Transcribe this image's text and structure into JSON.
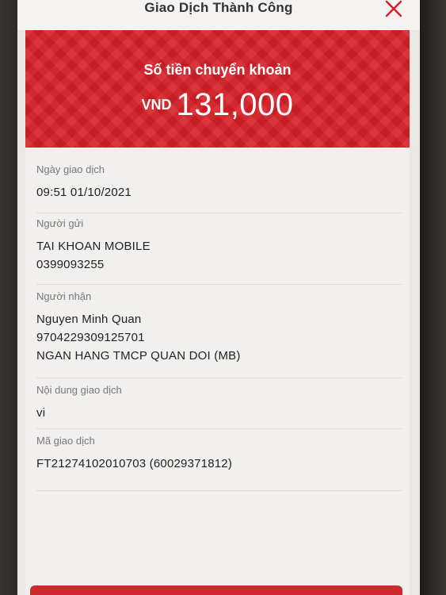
{
  "header": {
    "title": "Giao Dịch Thành Công"
  },
  "summary": {
    "label": "Số tiền chuyển khoản",
    "currency": "VND",
    "amount": "131,000"
  },
  "details": {
    "date": {
      "label": "Ngày giao dịch",
      "value": "09:51 01/10/2021"
    },
    "sender": {
      "label": "Người gửi",
      "name": "TAI KHOAN MOBILE",
      "account": "0399093255"
    },
    "recipient": {
      "label": "Người nhận",
      "name": "Nguyen Minh Quan",
      "account": "9704229309125701",
      "bank": "NGAN HANG TMCP QUAN DOI (MB)"
    },
    "content": {
      "label": "Nội dung giao dịch",
      "value": "vi"
    },
    "transaction_id": {
      "label": "Mã giao dịch",
      "value": "FT21274102010703 (60029371812)"
    }
  },
  "colors": {
    "primary_red": "#d71f26",
    "background": "#f1f0ee"
  },
  "icons": {
    "close": "close-icon"
  }
}
